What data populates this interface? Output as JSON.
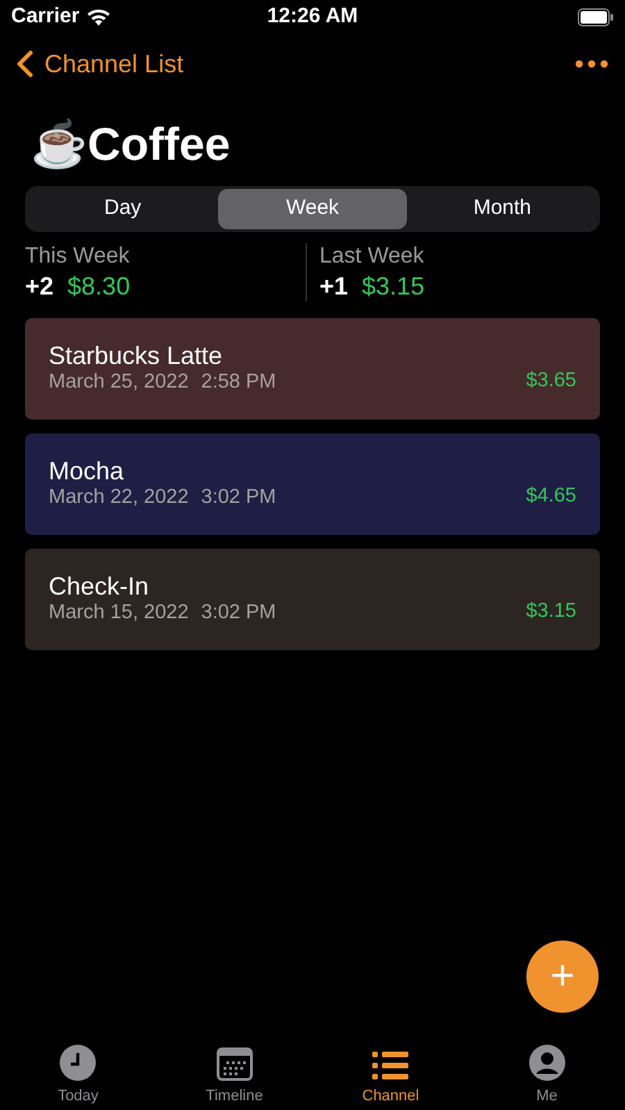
{
  "status_bar": {
    "carrier": "Carrier",
    "time": "12:26 AM"
  },
  "nav": {
    "back_label": "Channel List"
  },
  "title": "☕Coffee",
  "segments": [
    {
      "label": "Day",
      "selected": false
    },
    {
      "label": "Week",
      "selected": true
    },
    {
      "label": "Month",
      "selected": false
    }
  ],
  "stats": [
    {
      "label": "This Week",
      "count": "+2",
      "amount": "$8.30"
    },
    {
      "label": "Last Week",
      "count": "+1",
      "amount": "$3.15"
    }
  ],
  "entries": [
    {
      "name": "Starbucks Latte",
      "date": "March 25, 2022",
      "time": "2:58 PM",
      "amount": "$3.65",
      "color": "#472b2c"
    },
    {
      "name": "Mocha",
      "date": "March 22, 2022",
      "time": "3:02 PM",
      "amount": "$4.65",
      "color": "#1f1f45"
    },
    {
      "name": "Check-In",
      "date": "March 15, 2022",
      "time": "3:02 PM",
      "amount": "$3.15",
      "color": "#2c2522"
    }
  ],
  "add_button": {
    "label": "+"
  },
  "tab_bar": [
    {
      "kind": "clock",
      "label": "Today",
      "selected": false
    },
    {
      "kind": "calendar",
      "label": "Timeline",
      "selected": false
    },
    {
      "kind": "list",
      "label": "Channel",
      "selected": true
    },
    {
      "kind": "person",
      "label": "Me",
      "selected": false
    }
  ]
}
